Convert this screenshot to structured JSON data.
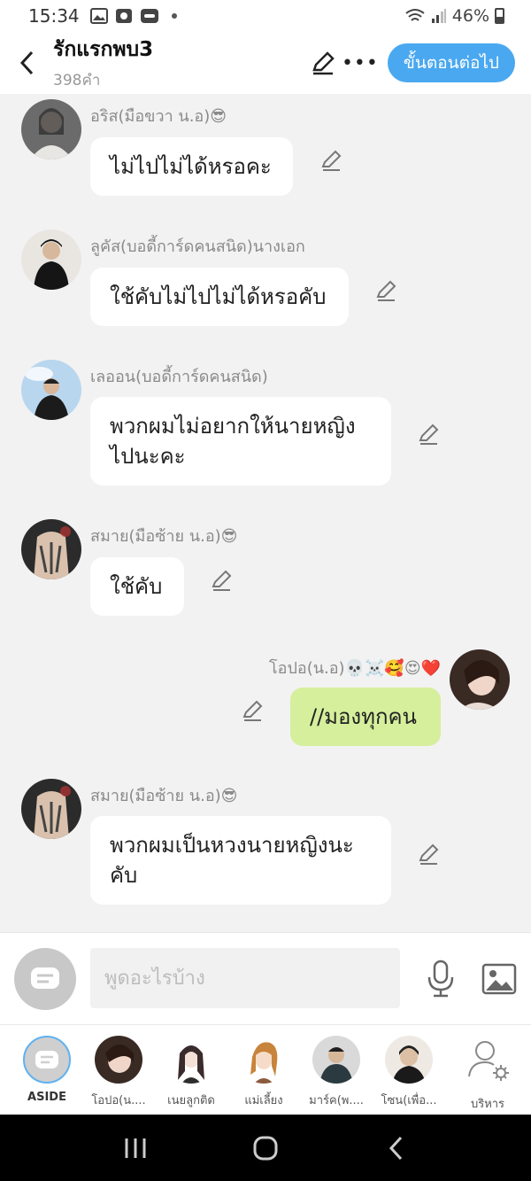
{
  "status_bar": {
    "time": "15:34",
    "battery": "46%",
    "icons": [
      "image-icon",
      "camera-icon",
      "lazada-icon",
      "wifi-icon",
      "signal-icon",
      "battery-icon"
    ]
  },
  "header": {
    "title": "รักแรกพบ3",
    "subtitle": "398คำ",
    "next_button": "ขั้นตอนต่อไป"
  },
  "messages": [
    {
      "sender": "อริส(มือขวา น.อ)😎",
      "text": "ไม่ไปไม่ได้หรอคะ",
      "mine": false
    },
    {
      "sender": "ลูคัส(บอดี้การ์ดคนสนิด)นางเอก",
      "text": "ใช้คับไม่ไปไม่ได้หรอคับ",
      "mine": false
    },
    {
      "sender": "เลออน(บอดี้การ์ดคนสนิด)",
      "text": "พวกผมไม่อยากให้นายหญิงไปนะคะ",
      "mine": false
    },
    {
      "sender": "สมาย(มือซ้าย น.อ)😎",
      "text": "ใช้คับ",
      "mine": false
    },
    {
      "sender": "โอปอ(น.อ)💀☠️🥰😍❤️",
      "text": "//มองทุกคน",
      "mine": true
    },
    {
      "sender": "สมาย(มือซ้าย น.อ)😎",
      "text": "พวกผมเป็นหวงนายหญิงนะคับ",
      "mine": false
    }
  ],
  "input": {
    "placeholder": "พูดอะไรบ้าง"
  },
  "characters": [
    {
      "name": "ASIDE"
    },
    {
      "name": "โอปอ(น...."
    },
    {
      "name": "เนยลูกติด"
    },
    {
      "name": "แม่เลี้ยง"
    },
    {
      "name": "มาร์ค(พ...."
    },
    {
      "name": "โซน(เพื่อ..."
    },
    {
      "name": "บริหาร"
    }
  ],
  "colors": {
    "accent": "#4aa8f0",
    "my_bubble": "#d5ef9c",
    "background": "#f2f2f2"
  }
}
